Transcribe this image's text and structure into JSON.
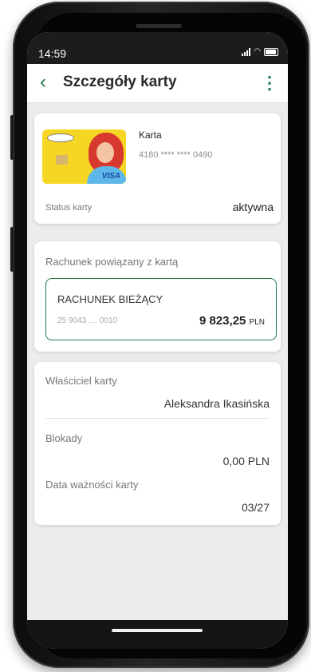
{
  "status_bar": {
    "time": "14:59",
    "signal_icon": "signal-icon",
    "wifi_icon": "wifi-icon",
    "battery_icon": "battery-icon"
  },
  "app_bar": {
    "title": "Szczegóły karty",
    "back_icon": "chevron-left-icon",
    "menu_icon": "more-vertical-icon"
  },
  "card": {
    "name": "Karta",
    "number": "4180 **** **** 0490",
    "status_label": "Status karty",
    "status_value": "aktywna",
    "network": "VISA"
  },
  "linked_account": {
    "section_label": "Rachunek powiązany z kartą",
    "name": "RACHUNEK BIEŻĄCY",
    "number": "25 9043 .... 0010",
    "balance": "9 823,25",
    "currency": "PLN"
  },
  "details": {
    "owner_label": "Właściciel karty",
    "owner_value": "Aleksandra Ikasińska",
    "blocks_label": "Blokady",
    "blocks_value": "0,00 PLN",
    "expiry_label": "Data ważności karty",
    "expiry_value": "03/27"
  },
  "colors": {
    "accent": "#1f7a46",
    "background": "#ececec",
    "card": "#ffffff"
  }
}
